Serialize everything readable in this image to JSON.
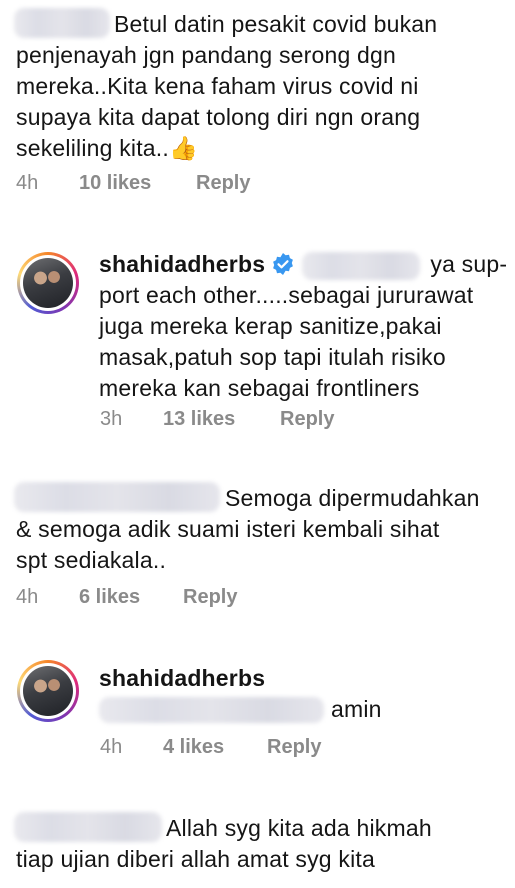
{
  "comments": [
    {
      "id": "c1",
      "text_parts": [
        "Betul datin pesakit covid bukan",
        "penjenayah jgn pandang serong dgn",
        "mereka..Kita kena faham virus covid ni",
        "supaya kita dapat tolong diri ngn orang",
        "sekeliling kita.."
      ],
      "emoji": "👍",
      "time": "4h",
      "likes": "10 likes",
      "reply": "Reply"
    },
    {
      "id": "c2",
      "username": "shahidadherbs",
      "verified": true,
      "lines": [
        "ya sup-",
        "port each other.....sebagai jururawat",
        "juga mereka kerap sanitize,pakai",
        "masak,patuh sop tapi itulah risiko",
        "mereka kan sebagai frontliners"
      ],
      "time": "3h",
      "likes": "13 likes",
      "reply": "Reply"
    },
    {
      "id": "c3",
      "lines": [
        "Semoga dipermudahkan",
        "& semoga adik suami isteri kembali sihat",
        "spt sediakala.."
      ],
      "time": "4h",
      "likes": "6 likes",
      "reply": "Reply"
    },
    {
      "id": "c4",
      "username": "shahidadherbs",
      "lines": [
        "amin"
      ],
      "time": "4h",
      "likes": "4 likes",
      "reply": "Reply"
    },
    {
      "id": "c5",
      "lines": [
        "Allah  syg  kita  ada  hikmah",
        "tiap  ujian  diberi  allah  amat  syg  kita"
      ]
    }
  ]
}
